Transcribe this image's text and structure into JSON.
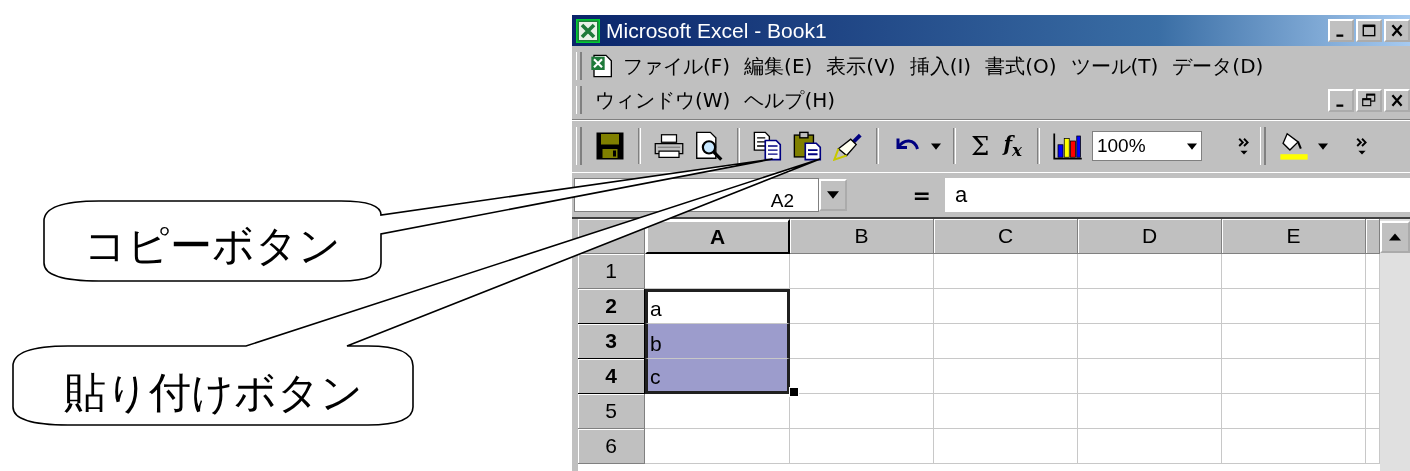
{
  "window": {
    "title": "Microsoft Excel - Book1"
  },
  "menu_bar": {
    "rows": [
      [
        {
          "label": "ファイル(F)"
        },
        {
          "label": "編集(E)"
        },
        {
          "label": "表示(V)"
        },
        {
          "label": "挿入(I)"
        },
        {
          "label": "書式(O)"
        },
        {
          "label": "ツール(T)"
        },
        {
          "label": "データ(D)"
        }
      ],
      [
        {
          "label": "ウィンドウ(W)"
        },
        {
          "label": "ヘルプ(H)"
        }
      ]
    ]
  },
  "toolbar": {
    "items": [
      {
        "kind": "save"
      },
      {
        "kind": "separator"
      },
      {
        "kind": "print"
      },
      {
        "kind": "preview"
      },
      {
        "kind": "separator"
      },
      {
        "kind": "copy"
      },
      {
        "kind": "paste"
      },
      {
        "kind": "painter"
      },
      {
        "kind": "separator"
      },
      {
        "kind": "undo"
      },
      {
        "kind": "separator"
      },
      {
        "kind": "sum",
        "label": "Σ"
      },
      {
        "kind": "function",
        "label": "f$_{x}$"
      },
      {
        "kind": "separator"
      },
      {
        "kind": "chart"
      },
      {
        "kind": "zoom",
        "value": "100%"
      },
      {
        "kind": "more"
      },
      {
        "kind": "grip"
      },
      {
        "kind": "fill"
      },
      {
        "kind": "more"
      }
    ]
  },
  "formula_bar": {
    "name_box": "A2",
    "equals": "=",
    "formula": "a"
  },
  "sheet": {
    "columns": [
      {
        "label": "A",
        "selected": true
      },
      {
        "label": "B",
        "selected": false
      },
      {
        "label": "C",
        "selected": false
      },
      {
        "label": "D",
        "selected": false
      },
      {
        "label": "E",
        "selected": false
      }
    ],
    "rows": [
      {
        "label": "1",
        "selected": false,
        "cells": [
          {
            "selected": false,
            "active": false
          }
        ]
      },
      {
        "label": "2",
        "selected": true,
        "cells": [
          {
            "value": "a",
            "selected": true,
            "active": true
          }
        ]
      },
      {
        "label": "3",
        "selected": true,
        "cells": [
          {
            "value": "b",
            "selected": true,
            "active": false
          }
        ]
      },
      {
        "label": "4",
        "selected": true,
        "cells": [
          {
            "value": "c",
            "selected": true,
            "active": false
          }
        ]
      },
      {
        "label": "5",
        "selected": false,
        "cells": [
          {
            "selected": false,
            "active": false
          }
        ]
      },
      {
        "label": "6",
        "selected": false,
        "cells": [
          {
            "selected": false,
            "active": false
          }
        ]
      }
    ]
  },
  "callouts": [
    {
      "text": "コピーボタン"
    },
    {
      "text": "貼り付けボタン"
    }
  ]
}
